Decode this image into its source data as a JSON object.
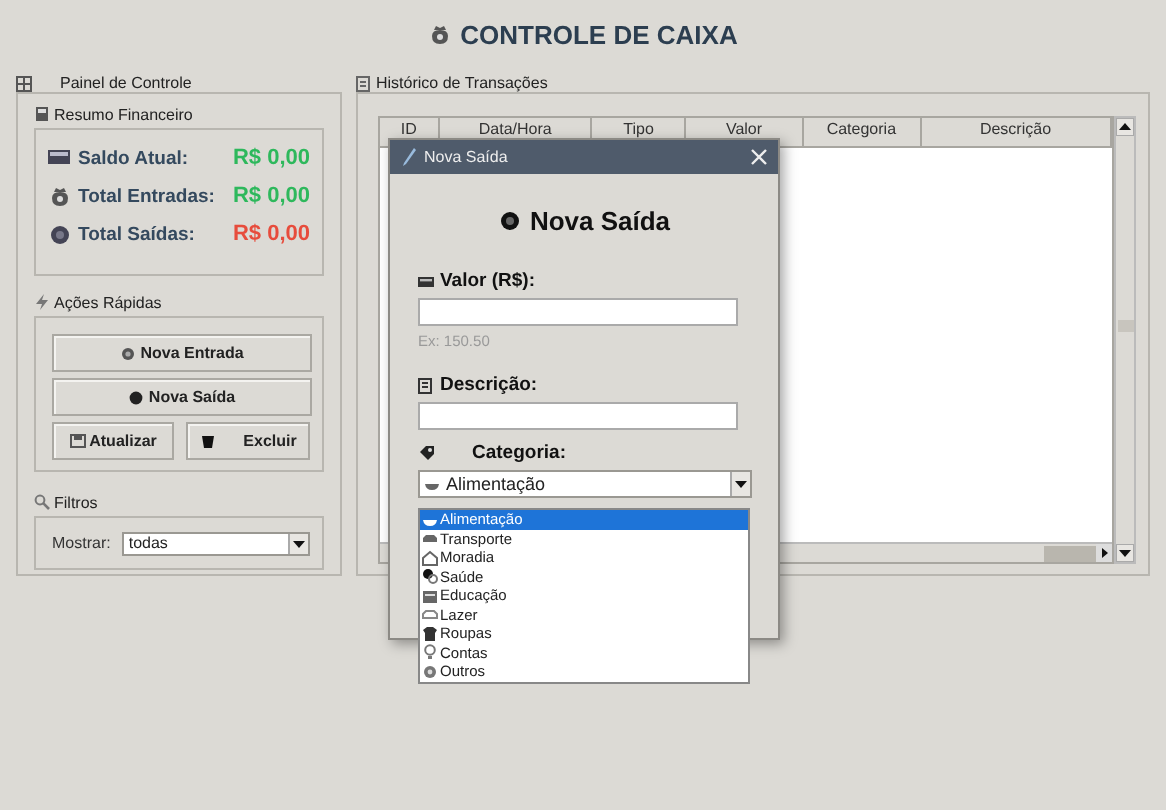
{
  "app": {
    "title": "CONTROLE DE CAIXA"
  },
  "control_panel": {
    "title": "Painel de Controle",
    "summary": {
      "title": "Resumo Financeiro",
      "rows": [
        {
          "label": "Saldo Atual:",
          "value": "R$ 0,00",
          "color": "#2eb85c"
        },
        {
          "label": "Total Entradas:",
          "value": "R$ 0,00",
          "color": "#2eb85c"
        },
        {
          "label": "Total Saídas:",
          "value": "R$ 0,00",
          "color": "#e74c3c"
        }
      ]
    },
    "actions": {
      "title": "Ações Rápidas",
      "buttons": [
        {
          "label": "Nova Entrada",
          "kind": "wide"
        },
        {
          "label": "Nova Saída",
          "kind": "wide"
        },
        {
          "label": "Atualizar",
          "kind": "half"
        },
        {
          "label": "Excluir",
          "kind": "half"
        }
      ]
    },
    "filters": {
      "title": "Filtros",
      "label": "Mostrar:",
      "value": "todas"
    }
  },
  "history": {
    "title": "Histórico de Transações",
    "columns": [
      "ID",
      "Data/Hora",
      "Tipo",
      "Valor",
      "Categoria",
      "Descrição"
    ]
  },
  "dialog": {
    "title": "Nova Saída",
    "heading": "Nova Saída",
    "fields": [
      {
        "label": "Valor (R$):",
        "hint": "Ex: 150.50"
      },
      {
        "label": "Descrição:"
      }
    ],
    "category": {
      "label": "Categoria:",
      "value": "Alimentação",
      "options": [
        {
          "label": "Alimentação",
          "selected": true
        },
        {
          "label": "Transporte",
          "selected": false
        },
        {
          "label": "Moradia",
          "selected": false
        },
        {
          "label": "Saúde",
          "selected": false
        },
        {
          "label": "Educação",
          "selected": false
        },
        {
          "label": "Lazer",
          "selected": false
        },
        {
          "label": "Roupas",
          "selected": false
        },
        {
          "label": "Contas",
          "selected": false
        },
        {
          "label": "Outros",
          "selected": false
        }
      ]
    }
  }
}
